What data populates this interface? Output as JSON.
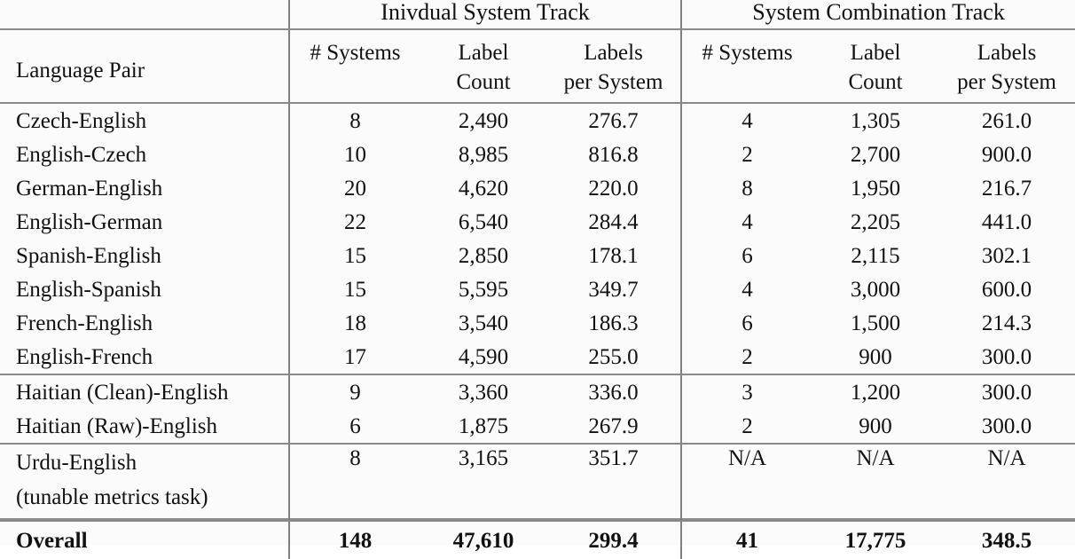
{
  "table": {
    "group_headers": {
      "language_pair_blank": "",
      "individual": "Inivdual System Track",
      "combination": "System Combination Track"
    },
    "column_headers": {
      "language_pair": "Language Pair",
      "ind_systems": "# Systems",
      "ind_label_l1": "Label",
      "ind_label_l2": "Count",
      "ind_per_l1": "Labels",
      "ind_per_l2": "per System",
      "comb_systems": "# Systems",
      "comb_label_l1": "Label",
      "comb_label_l2": "Count",
      "comb_per_l1": "Labels",
      "comb_per_l2": "per System"
    },
    "rows": [
      {
        "pair": "Czech-English",
        "ind_systems": "8",
        "ind_count": "2,490",
        "ind_per": "276.7",
        "comb_systems": "4",
        "comb_count": "1,305",
        "comb_per": "261.0"
      },
      {
        "pair": "English-Czech",
        "ind_systems": "10",
        "ind_count": "8,985",
        "ind_per": "816.8",
        "comb_systems": "2",
        "comb_count": "2,700",
        "comb_per": "900.0"
      },
      {
        "pair": "German-English",
        "ind_systems": "20",
        "ind_count": "4,620",
        "ind_per": "220.0",
        "comb_systems": "8",
        "comb_count": "1,950",
        "comb_per": "216.7"
      },
      {
        "pair": "English-German",
        "ind_systems": "22",
        "ind_count": "6,540",
        "ind_per": "284.4",
        "comb_systems": "4",
        "comb_count": "2,205",
        "comb_per": "441.0"
      },
      {
        "pair": "Spanish-English",
        "ind_systems": "15",
        "ind_count": "2,850",
        "ind_per": "178.1",
        "comb_systems": "6",
        "comb_count": "2,115",
        "comb_per": "302.1"
      },
      {
        "pair": "English-Spanish",
        "ind_systems": "15",
        "ind_count": "5,595",
        "ind_per": "349.7",
        "comb_systems": "4",
        "comb_count": "3,000",
        "comb_per": "600.0"
      },
      {
        "pair": "French-English",
        "ind_systems": "18",
        "ind_count": "3,540",
        "ind_per": "186.3",
        "comb_systems": "6",
        "comb_count": "1,500",
        "comb_per": "214.3"
      },
      {
        "pair": "English-French",
        "ind_systems": "17",
        "ind_count": "4,590",
        "ind_per": "255.0",
        "comb_systems": "2",
        "comb_count": "900",
        "comb_per": "300.0"
      }
    ],
    "haitian_rows": [
      {
        "pair": "Haitian (Clean)-English",
        "ind_systems": "9",
        "ind_count": "3,360",
        "ind_per": "336.0",
        "comb_systems": "3",
        "comb_count": "1,200",
        "comb_per": "300.0"
      },
      {
        "pair": "Haitian (Raw)-English",
        "ind_systems": "6",
        "ind_count": "1,875",
        "ind_per": "267.9",
        "comb_systems": "2",
        "comb_count": "900",
        "comb_per": "300.0"
      }
    ],
    "urdu_row": {
      "pair_line1": "Urdu-English",
      "pair_line2": "(tunable metrics task)",
      "ind_systems": "8",
      "ind_count": "3,165",
      "ind_per": "351.7",
      "comb_systems": "N/A",
      "comb_count": "N/A",
      "comb_per": "N/A"
    },
    "overall_row": {
      "pair": "Overall",
      "ind_systems": "148",
      "ind_count": "47,610",
      "ind_per": "299.4",
      "comb_systems": "41",
      "comb_count": "17,775",
      "comb_per": "348.5"
    }
  }
}
